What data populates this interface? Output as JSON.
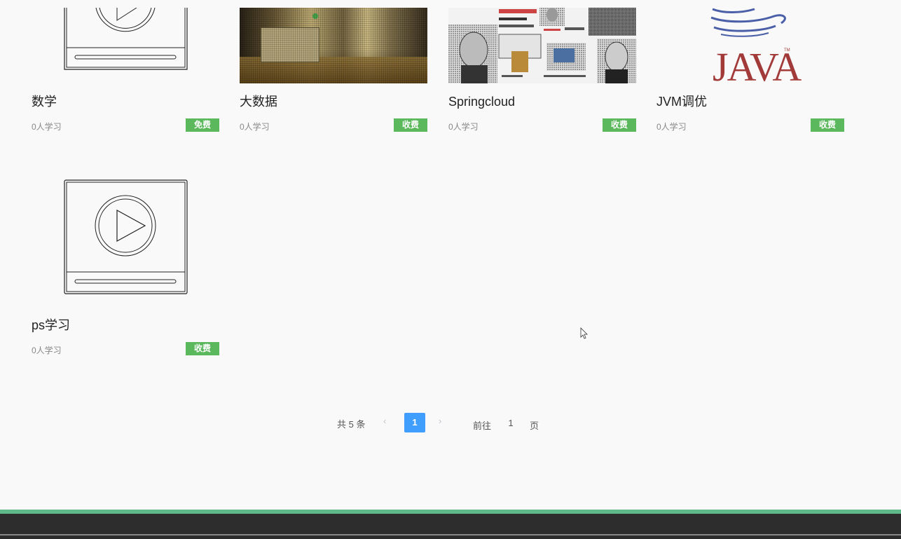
{
  "courses": [
    {
      "title": "数学",
      "learners": "0人学习",
      "price": "免费",
      "thumbnail": "video-placeholder-icon"
    },
    {
      "title": "大数据",
      "learners": "0人学习",
      "price": "收费",
      "thumbnail": "office-scene-photo"
    },
    {
      "title": "Springcloud",
      "learners": "0人学习",
      "price": "收费",
      "thumbnail": "photo-collage"
    },
    {
      "title": "JVM调优",
      "learners": "0人学习",
      "price": "收费",
      "thumbnail": "java-logo",
      "thumbnail_text": "JAVA"
    },
    {
      "title": "ps学习",
      "learners": "0人学习",
      "price": "收费",
      "thumbnail": "video-placeholder-icon"
    }
  ],
  "pagination": {
    "total": "共 5 条",
    "prev": "‹",
    "next": "›",
    "current_page": "1",
    "goto_label": "前往",
    "goto_value": "1",
    "goto_suffix": "页"
  },
  "colors": {
    "price_tag": "#5cb85c",
    "active_page": "#409eff",
    "footer_accent": "#5fb98a",
    "footer_bar": "#2d2d2d",
    "java_red": "#a33a3a",
    "java_blue": "#4a5fa8"
  }
}
